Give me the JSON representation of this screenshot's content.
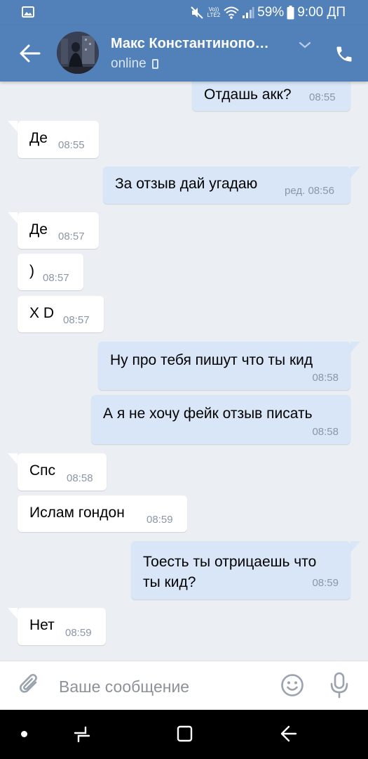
{
  "status_bar": {
    "battery": "59%",
    "clock": "9:00 ДП",
    "volte_top": "Vo))",
    "volte_bottom": "LTE2"
  },
  "header": {
    "contact_name": "Макс Константинопо…",
    "status": "online"
  },
  "messages": [
    {
      "dir": "out",
      "text": "Отдашь акк?",
      "time": "08:55"
    },
    {
      "dir": "in",
      "text": "Де",
      "time": "08:55"
    },
    {
      "dir": "out",
      "text": "За отзыв дай угадаю",
      "time": "ред. 08:56"
    },
    {
      "dir": "in",
      "text": "Де",
      "time": "08:57"
    },
    {
      "dir": "in",
      "text": ")",
      "time": "08:57"
    },
    {
      "dir": "in",
      "text": "X D",
      "time": "08:57"
    },
    {
      "dir": "out",
      "text": "Ну про тебя пишут что ты кид",
      "time": "08:58"
    },
    {
      "dir": "out",
      "text": "А я не хочу фейк отзыв писать",
      "time": "08:58"
    },
    {
      "dir": "in",
      "text": "Спс",
      "time": "08:58"
    },
    {
      "dir": "in",
      "text": "Ислам гондон",
      "time": "08:59"
    },
    {
      "dir": "out",
      "text_line1": "Тоесть ты отрицаешь что",
      "text_line2": "ты кид?",
      "time": "08:59"
    },
    {
      "dir": "in",
      "text": "Нет",
      "time": "08:59"
    }
  ],
  "composer": {
    "placeholder": "Ваше сообщение"
  },
  "colors": {
    "header_bg": "#5181b8",
    "chat_bg": "#ebeef2",
    "incoming_bubble": "#ffffff",
    "outgoing_bubble": "#d8e6f7",
    "timestamp": "#8a97a6"
  },
  "icons": [
    "gallery-icon",
    "mute-icon",
    "wifi-icon",
    "signal-icon",
    "battery-icon",
    "back-arrow-icon",
    "chevron-down-icon",
    "phone-icon",
    "paperclip-icon",
    "emoji-icon",
    "microphone-icon"
  ]
}
